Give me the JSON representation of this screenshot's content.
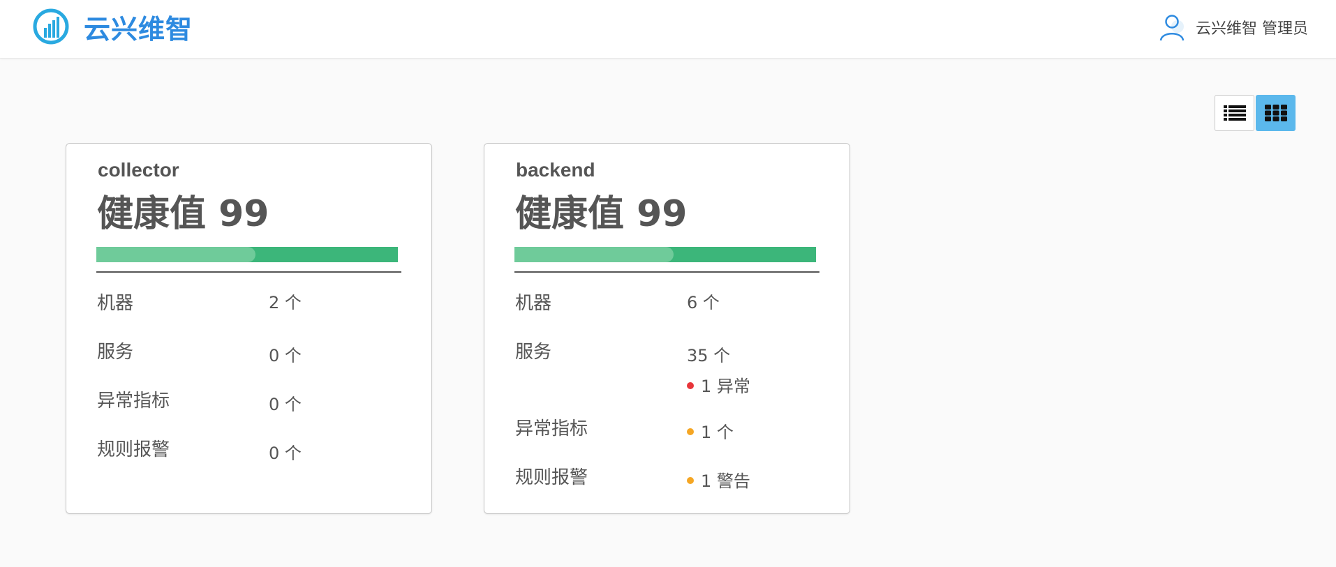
{
  "app": {
    "title": "云兴维智",
    "accent": "#2d8ae0"
  },
  "user": {
    "name": "云兴维智 管理员"
  },
  "view_toggle": {
    "active": "grid"
  },
  "cards": [
    {
      "name": "collector",
      "health": "健康值 99",
      "health_value": 99,
      "rows": {
        "machines": {
          "label": "机器",
          "value": "2 个"
        },
        "services": {
          "label": "服务",
          "value": "0 个"
        },
        "anomalies": {
          "label": "异常指标",
          "value": "0 个"
        },
        "alerts": {
          "label": "规则报警",
          "value": "0 个"
        }
      }
    },
    {
      "name": "backend",
      "health": "健康值 99",
      "health_value": 99,
      "rows": {
        "machines": {
          "label": "机器",
          "value": "6 个"
        },
        "services": {
          "label": "服务",
          "value": "35 个",
          "sub": "1 异常",
          "sub_color": "#e8353a"
        },
        "anomalies": {
          "label": "异常指标",
          "value": "1 个",
          "value_color": "#f5a623"
        },
        "alerts": {
          "label": "规则报警",
          "value": "1 警告",
          "value_color": "#f5a623"
        }
      }
    }
  ],
  "colors": {
    "bar": "#3cb67a",
    "bar_highlight": "#6fcb9a",
    "toggle_active": "#5bb8ec"
  }
}
